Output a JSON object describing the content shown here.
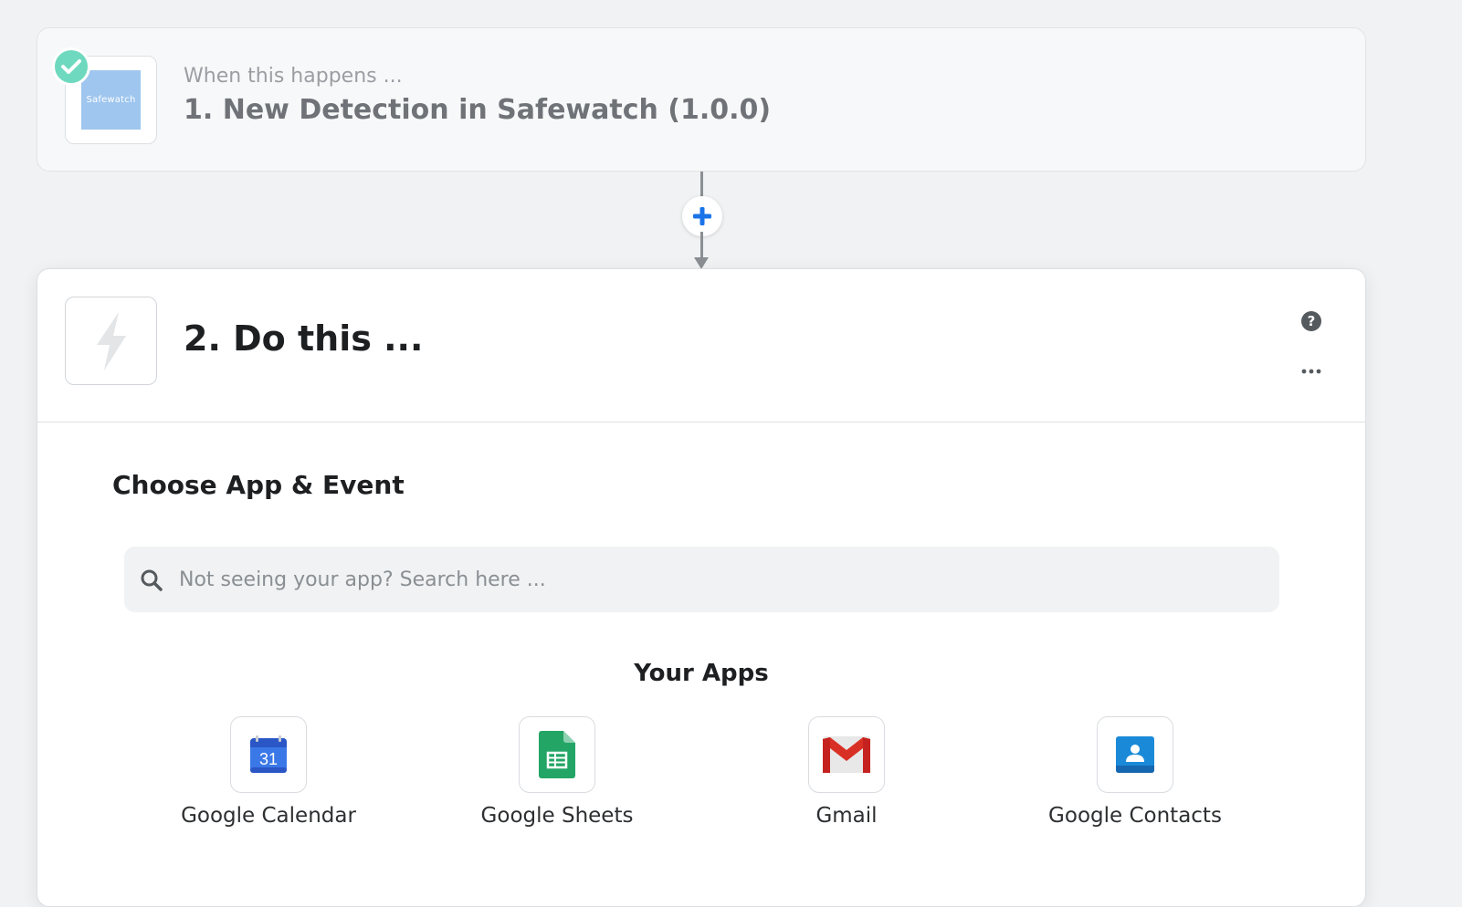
{
  "trigger": {
    "app_logo_text": "Safewatch",
    "kicker": "When this happens ...",
    "title": "1. New Detection in Safewatch (1.0.0)"
  },
  "action": {
    "title": "2. Do this ...",
    "section_title": "Choose App & Event",
    "search": {
      "placeholder": "Not seeing your app? Search here ...",
      "value": ""
    },
    "your_apps_title": "Your Apps",
    "apps": [
      {
        "label": "Google Calendar",
        "icon": "google-calendar-icon",
        "day": "31"
      },
      {
        "label": "Google Sheets",
        "icon": "google-sheets-icon"
      },
      {
        "label": "Gmail",
        "icon": "gmail-icon"
      },
      {
        "label": "Google Contacts",
        "icon": "google-contacts-icon"
      }
    ]
  },
  "colors": {
    "background": "#f0f2f3",
    "check_badge": "#6fd9bf",
    "add_plus": "#1a73e8",
    "safewatch_logo": "#9fc6ee"
  }
}
